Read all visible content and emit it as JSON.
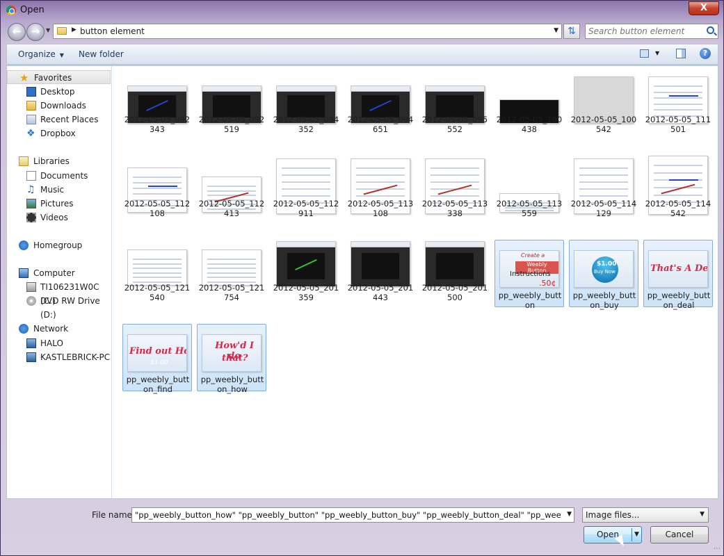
{
  "window": {
    "title": "Open",
    "close_label": "X"
  },
  "address": {
    "crumb": "button element",
    "search_placeholder": "Search button element"
  },
  "toolbar": {
    "organize": "Organize",
    "new_folder": "New folder",
    "help": "?"
  },
  "nav": {
    "favorites": "Favorites",
    "favorites_items": [
      "Desktop",
      "Downloads",
      "Recent Places",
      "Dropbox"
    ],
    "libraries": "Libraries",
    "libraries_items": [
      "Documents",
      "Music",
      "Pictures",
      "Videos"
    ],
    "homegroup": "Homegroup",
    "computer": "Computer",
    "computer_items": [
      "TI106231W0C (C:)",
      "DVD RW Drive (D:)"
    ],
    "network": "Network",
    "network_items": [
      "HALO",
      "KASTLEBRICK-PC"
    ]
  },
  "files": [
    "2012-05-05_092343",
    "2012-05-05_092519",
    "2012-05-05_094352",
    "2012-05-05_094651",
    "2012-05-05_095552",
    "2012-05-05_100438",
    "2012-05-05_100542",
    "2012-05-05_111501",
    "2012-05-05_112108",
    "2012-05-05_112413",
    "2012-05-05_112911",
    "2012-05-05_113108",
    "2012-05-05_113338",
    "2012-05-05_113559",
    "2012-05-05_114129",
    "2012-05-05_114542",
    "2012-05-05_121540",
    "2012-05-05_121754",
    "2012-05-05_201359",
    "2012-05-05_201443",
    "2012-05-05_201500",
    "pp_weebly_button",
    "pp_weebly_button_buy",
    "pp_weebly_button_deal",
    "pp_weebly_button_find",
    "pp_weebly_button_how"
  ],
  "thumb_text": {
    "button_buy_price": "$1.00",
    "button_buy_label": "Buy Now",
    "deal": "That's A Deal",
    "find": "Find out How",
    "find_price": "$1.00",
    "how_1": "How'd I do",
    "how_2": "that?",
    "create_1": "Create a",
    "create_2": "Weebly Button",
    "create_3": "Instructions",
    "create_price": ".50¢"
  },
  "bottom": {
    "file_name_label": "File name:",
    "file_name_value": "\"pp_weebly_button_how\" \"pp_weebly_button\" \"pp_weebly_button_buy\" \"pp_weebly_button_deal\" \"pp_weebly_button_fin",
    "filter": "Image files...",
    "open": "Open",
    "cancel": "Cancel"
  },
  "colors": {
    "selection": "#cde3f8",
    "accent": "#3c7fb1"
  }
}
